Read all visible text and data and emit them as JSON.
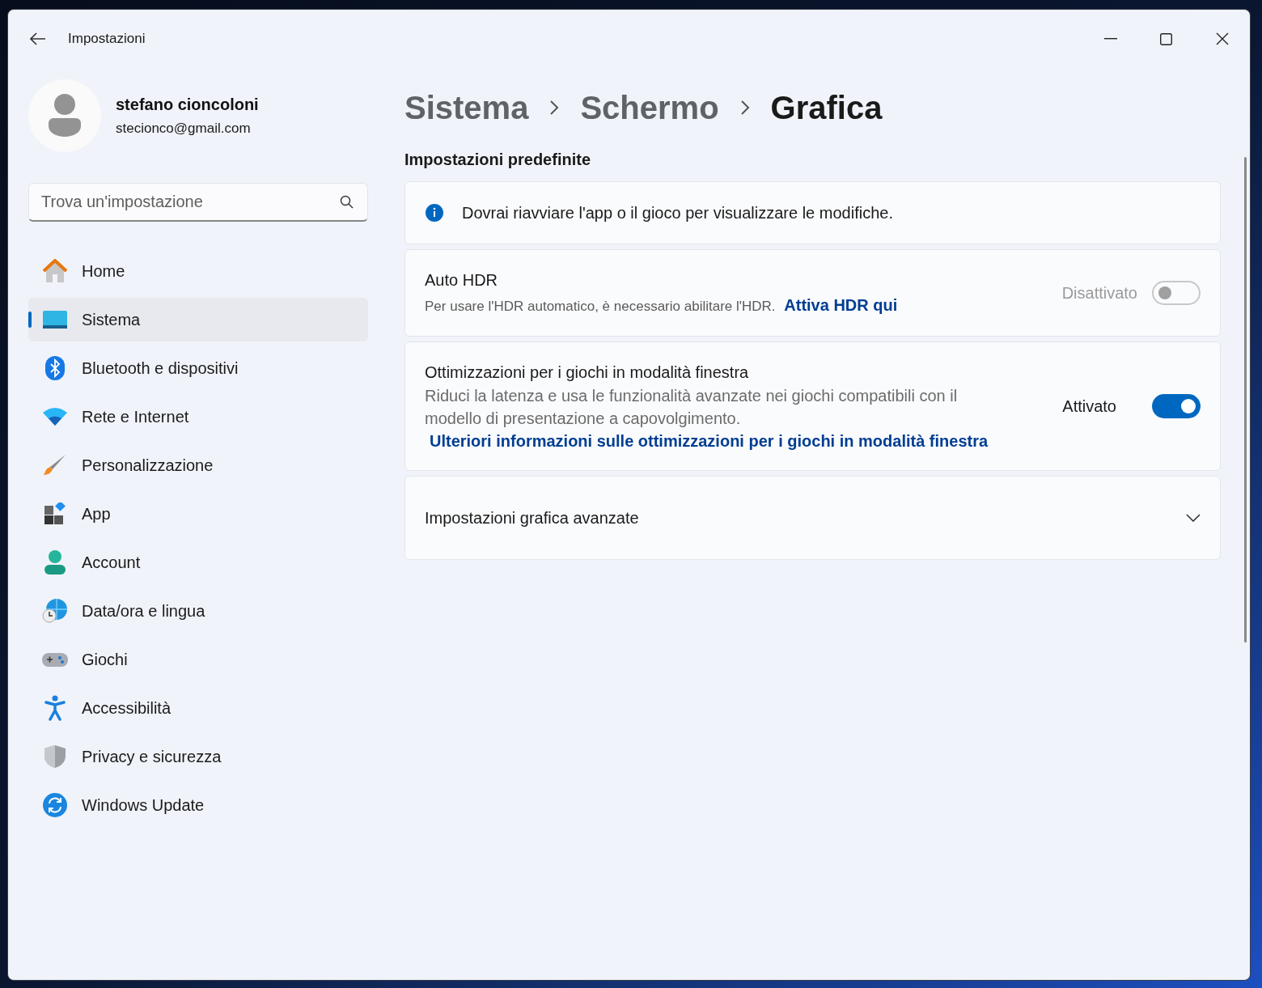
{
  "window": {
    "title": "Impostazioni"
  },
  "user": {
    "name": "stefano cioncoloni",
    "email": "stecionco@gmail.com"
  },
  "search": {
    "placeholder": "Trova un'impostazione"
  },
  "sidebar": {
    "items": [
      {
        "label": "Home",
        "selected": false
      },
      {
        "label": "Sistema",
        "selected": true
      },
      {
        "label": "Bluetooth e dispositivi",
        "selected": false
      },
      {
        "label": "Rete e Internet",
        "selected": false
      },
      {
        "label": "Personalizzazione",
        "selected": false
      },
      {
        "label": "App",
        "selected": false
      },
      {
        "label": "Account",
        "selected": false
      },
      {
        "label": "Data/ora e lingua",
        "selected": false
      },
      {
        "label": "Giochi",
        "selected": false
      },
      {
        "label": "Accessibilità",
        "selected": false
      },
      {
        "label": "Privacy e sicurezza",
        "selected": false
      },
      {
        "label": "Windows Update",
        "selected": false
      }
    ]
  },
  "breadcrumb": [
    "Sistema",
    "Schermo",
    "Grafica"
  ],
  "section_title": "Impostazioni predefinite",
  "cards": [
    {
      "kind": "info",
      "text": "Dovrai riavviare l'app o il gioco per visualizzare le modifiche."
    },
    {
      "kind": "toggle",
      "title": "Auto HDR",
      "description": "Per usare l'HDR automatico, è necessario abilitare l'HDR.",
      "link": "Attiva HDR qui",
      "state_label": "Disattivato",
      "on": false,
      "disabled": true
    },
    {
      "kind": "toggle",
      "title": "Ottimizzazioni per i giochi in modalità finestra",
      "description": "Riduci la latenza e usa le funzionalità avanzate nei giochi compatibili con il modello di presentazione a capovolgimento.",
      "link": "Ulteriori informazioni sulle ottimizzazioni per i giochi in modalità finestra",
      "state_label": "Attivato",
      "on": true,
      "disabled": false
    },
    {
      "kind": "expander",
      "title": "Impostazioni grafica avanzate",
      "expanded": false
    }
  ]
}
